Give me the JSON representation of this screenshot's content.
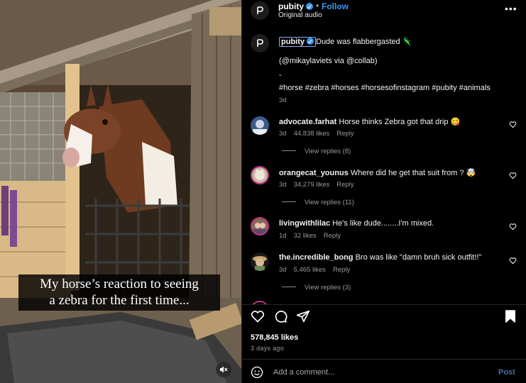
{
  "video": {
    "caption_line1": "My horse’s reaction to seeing",
    "caption_line2": "a zebra for the first time...",
    "mute_icon": "speaker-muted-icon"
  },
  "header": {
    "username": "pubity",
    "verified": true,
    "separator": "•",
    "follow_label": "Follow",
    "subtitle": "Original audio",
    "more_icon": "more-horizontal-icon"
  },
  "post": {
    "author": "pubity",
    "text": "Dude was flabbergasted 🦎",
    "credit": "(@mikaylaviets via @collab)",
    "dash": "-",
    "hashtags": "#horse #zebra #horses #horsesofinstagram #pubity #animals",
    "time": "3d"
  },
  "comments": [
    {
      "user": "advocate.farhat",
      "text": "Horse thinks Zebra got that drip 😋",
      "time": "3d",
      "likes": "44,838 likes",
      "reply": "Reply",
      "view_replies": "View replies (8)"
    },
    {
      "user": "orangecat_younus",
      "text": "Where did he get that suit from ? 🤯",
      "time": "3d",
      "likes": "34,279 likes",
      "reply": "Reply",
      "view_replies": "View replies (11)"
    },
    {
      "user": "livingwithlilac",
      "text": "He's like dude........I'm mixed.",
      "time": "1d",
      "likes": "32 likes",
      "reply": "Reply",
      "view_replies": ""
    },
    {
      "user": "the.incredible_bong",
      "text": "Bro was like \"damn bruh sick outfit!!\"",
      "time": "3d",
      "likes": "5,465 likes",
      "reply": "Reply",
      "view_replies": "View replies (3)"
    }
  ],
  "actions": {
    "like_icon": "heart-icon",
    "comment_icon": "comment-bubble-icon",
    "share_icon": "paper-plane-icon",
    "save_icon": "bookmark-icon"
  },
  "stats": {
    "likes": "578,845 likes",
    "posted": "3 days ago"
  },
  "composer": {
    "emoji_icon": "emoji-smile-icon",
    "placeholder": "Add a comment...",
    "post_label": "Post"
  },
  "colors": {
    "accent": "#3897f0",
    "background": "#000000",
    "muted_text": "#9a9a9a",
    "post_button": "#4a6d9c"
  }
}
